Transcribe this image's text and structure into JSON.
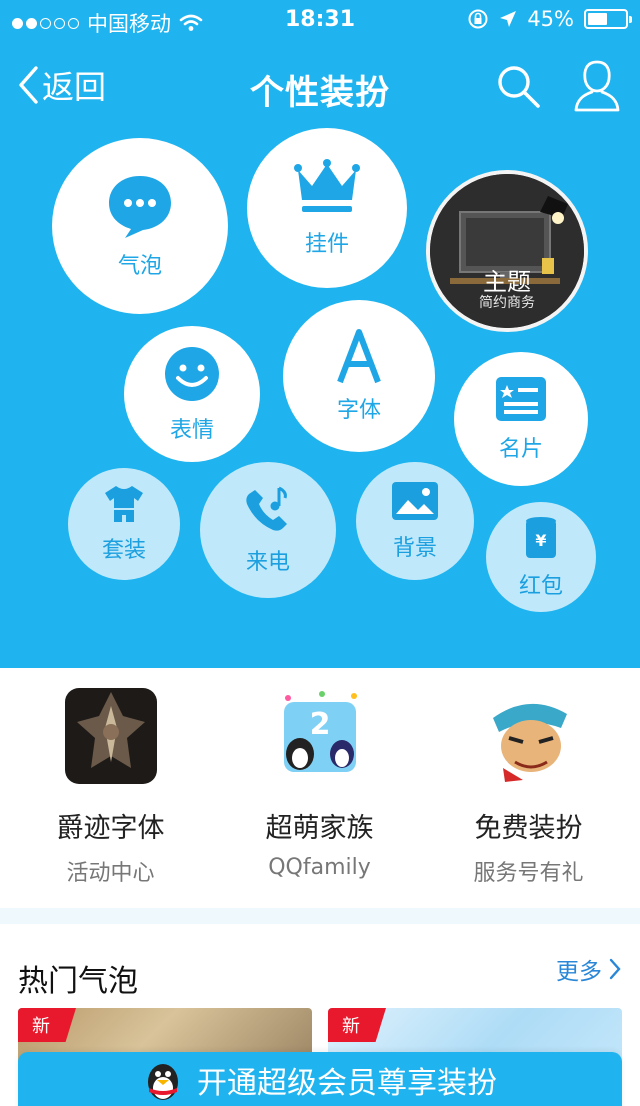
{
  "status_bar": {
    "carrier": "中国移动",
    "time": "18:31",
    "battery": "45%",
    "battery_level": 0.45,
    "signal_bars_filled": 2,
    "signal_bars_total": 5
  },
  "navbar": {
    "back_label": "返回",
    "title": "个性装扮"
  },
  "theme_card": {
    "title": "主题",
    "subtitle": "简约商务"
  },
  "categories": [
    {
      "label": "气泡",
      "icon": "chat-bubble-icon"
    },
    {
      "label": "挂件",
      "icon": "crown-icon"
    },
    {
      "label": "表情",
      "icon": "smiley-icon"
    },
    {
      "label": "字体",
      "icon": "font-a-icon"
    },
    {
      "label": "名片",
      "icon": "business-card-icon"
    },
    {
      "label": "套装",
      "icon": "tshirt-icon"
    },
    {
      "label": "来电",
      "icon": "phone-music-icon"
    },
    {
      "label": "背景",
      "icon": "picture-icon"
    },
    {
      "label": "红包",
      "icon": "red-packet-icon"
    }
  ],
  "promos": [
    {
      "title": "爵迹字体",
      "subtitle": "活动中心"
    },
    {
      "title": "超萌家族",
      "subtitle": "QQfamily"
    },
    {
      "title": "免费装扮",
      "subtitle": "服务号有礼"
    }
  ],
  "hot_section": {
    "title": "热门气泡",
    "more_label": "更多",
    "card_badges": [
      "新",
      "新"
    ]
  },
  "vip_button": {
    "label": "开通超级会员尊享装扮"
  },
  "colors": {
    "accent": "#1fb4ef",
    "badge_red": "#e8192c",
    "link_blue": "#2a87d8"
  }
}
